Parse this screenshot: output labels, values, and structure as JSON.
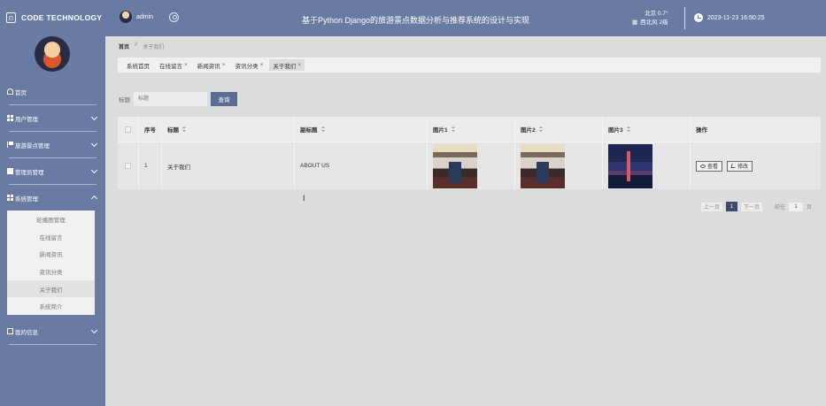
{
  "header": {
    "logo_text": "CODE TECHNOLOGY",
    "logo_icon": "file-icon",
    "username": "admin",
    "app_title": "基于Python Django的旅游景点数据分析与推荐系统的设计与实现",
    "weather_line1": "北京  0.7°",
    "weather_line2": "西北风  2级",
    "datetime": "2023-11-23 16:50:25"
  },
  "sidebar": {
    "items": [
      {
        "label": "首页",
        "icon": "home-icon",
        "expandable": false
      },
      {
        "label": "用户管理",
        "icon": "grid-icon",
        "expandable": true
      },
      {
        "label": "旅游景点管理",
        "icon": "flag-icon",
        "expandable": true
      },
      {
        "label": "管理员管理",
        "icon": "box-icon",
        "expandable": true
      },
      {
        "label": "系统管理",
        "icon": "grid-icon",
        "expandable": true,
        "expanded": true
      },
      {
        "label": "我的信息",
        "icon": "card-icon",
        "expandable": true
      }
    ],
    "submenu": [
      "轮播图管理",
      "在线留言",
      "新闻资讯",
      "资讯分类",
      "关于我们",
      "系统简介"
    ],
    "submenu_active": "关于我们"
  },
  "breadcrumb": {
    "home": "首页",
    "separator": "//",
    "current": "关于我们"
  },
  "tabs": [
    {
      "label": "系统首页",
      "closable": false
    },
    {
      "label": "在线留言",
      "closable": true
    },
    {
      "label": "新闻资讯",
      "closable": true
    },
    {
      "label": "资讯分类",
      "closable": true
    },
    {
      "label": "关于我们",
      "closable": true,
      "active": true
    }
  ],
  "search": {
    "label": "标题",
    "placeholder": "标题",
    "button": "查询"
  },
  "table": {
    "headers": [
      "序号",
      "标题",
      "副标题",
      "图片1",
      "图片2",
      "图片3",
      "操作"
    ],
    "rows": [
      {
        "index": "1",
        "title": "关于我们",
        "subtitle": "ABOUT US",
        "view_label": "查看",
        "edit_label": "修改"
      }
    ]
  },
  "pagination": {
    "prev": "上一页",
    "current": "1",
    "next": "下一页",
    "goto_label": "前往",
    "goto_value": "1",
    "page_suffix": "页"
  }
}
